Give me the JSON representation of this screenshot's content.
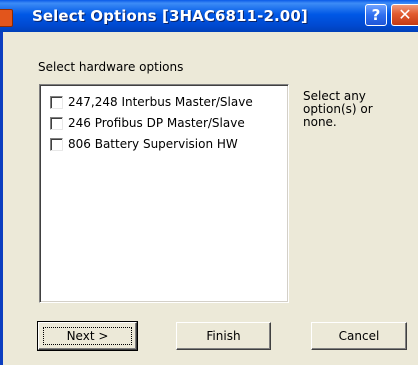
{
  "window": {
    "title": "Select Options [3HAC6811-2.00]",
    "help_glyph": "?",
    "close_glyph": "✕"
  },
  "section_label": "Select hardware options",
  "options": [
    {
      "label": "247,248 Interbus Master/Slave",
      "checked": false
    },
    {
      "label": "246 Profibus DP Master/Slave",
      "checked": false
    },
    {
      "label": "806 Battery Supervision HW",
      "checked": false
    }
  ],
  "hint": "Select any option(s) or none.",
  "buttons": {
    "next": "Next >",
    "finish": "Finish",
    "cancel": "Cancel"
  },
  "colors": {
    "titlebar": "#0058e6",
    "dialog_bg": "#ece9d8",
    "close_button": "#e15a2f"
  }
}
